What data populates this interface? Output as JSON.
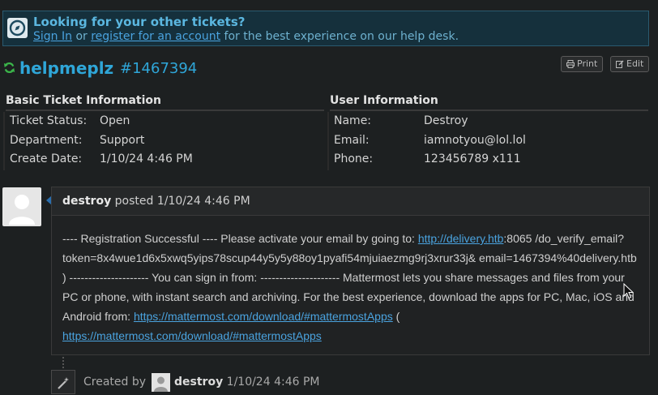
{
  "notice": {
    "title": "Looking for your other tickets?",
    "sign_in": "Sign In",
    "or": " or ",
    "register": "register for an account",
    "rest": " for the best experience on our help desk."
  },
  "ticket": {
    "subject": "helpmeplz",
    "number": "#1467394"
  },
  "buttons": {
    "print": "Print",
    "edit": "Edit"
  },
  "basic": {
    "heading": "Basic Ticket Information",
    "rows": [
      {
        "label": "Ticket Status:",
        "value": "Open"
      },
      {
        "label": "Department:",
        "value": "Support"
      },
      {
        "label": "Create Date:",
        "value": "1/10/24 4:46 PM"
      }
    ]
  },
  "user": {
    "heading": "User Information",
    "rows": [
      {
        "label": "Name:",
        "value": "Destroy"
      },
      {
        "label": "Email:",
        "value": "iamnotyou@lol.lol"
      },
      {
        "label": "Phone:",
        "value": "123456789 x111"
      }
    ]
  },
  "post": {
    "author": "destroy",
    "posted": " posted ",
    "date": "1/10/24 4:46 PM",
    "text1": "---- Registration Successful ---- Please activate your email by going to: ",
    "link1": "http://delivery.htb",
    "text2": ":8065 /do_verify_email?token=8x4wue1d6x5xwq5yips78scup44y5y5y88oy1pyafi54mjuiaezmg9rj3xrur33j& email=1467394%40delivery.htb ) --------------------- You can sign in from: --------------------- Mattermost lets you share messages and files from your PC or phone, with instant search and archiving. For the best experience, download the apps for PC, Mac, iOS and Android from: ",
    "link2": "https://mattermost.com/download/#mattermostApps",
    "text3": " ( ",
    "link3": "https://mattermost.com/download/#mattermostApps"
  },
  "event": {
    "created_by": "Created by",
    "author": "destroy",
    "date": "1/10/24 4:46 PM"
  }
}
